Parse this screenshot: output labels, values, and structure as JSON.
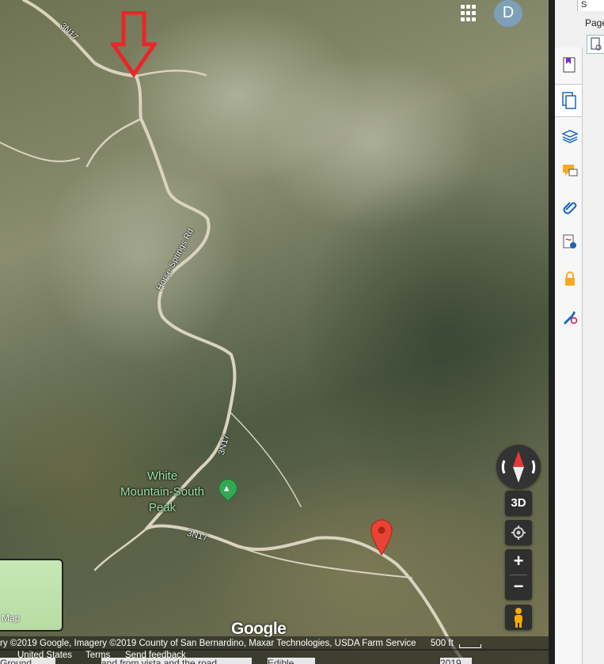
{
  "map": {
    "road_labels": {
      "top_left_3n17": "3N17",
      "horse_springs": "Horse Springs Rd",
      "middle_3n17": "3N17",
      "lower_3n17": "3N17"
    },
    "poi": {
      "line1": "White",
      "line2": "Mountain-South",
      "line3": "Peak",
      "icon": "mountain-icon",
      "color": "#34a853"
    },
    "pin_color": "#ea4335",
    "annotation_arrow_color": "#e8262a",
    "avatar_letter": "D",
    "apps_icon": "grid-icon",
    "controls": {
      "compass_icon": "compass-icon",
      "tilt_label": "3D",
      "location_icon": "my-location-icon",
      "zoom_in": "+",
      "zoom_out": "−",
      "pegman_icon": "pegman-icon"
    },
    "minimap_label": "Map",
    "logo": "Google",
    "attribution": "ry ©2019 Google, Imagery ©2019 County of San Bernardino, Maxar Technologies, USDA Farm Service",
    "scale_label": "500 ft",
    "footer": {
      "country": "United States",
      "terms": "Terms",
      "feedback": "Send feedback"
    },
    "underlay_text": {
      "a": "Ground",
      "b": "and from vista and the road",
      "c": "Edible",
      "d": "2019"
    }
  },
  "panel": {
    "tab": "S",
    "heading": "Page",
    "tools": [
      "bookmark-icon",
      "pages-icon",
      "layers-icon",
      "comment-icon",
      "attachment-icon",
      "signature-icon",
      "lock-icon",
      "pen-tool-icon"
    ]
  }
}
